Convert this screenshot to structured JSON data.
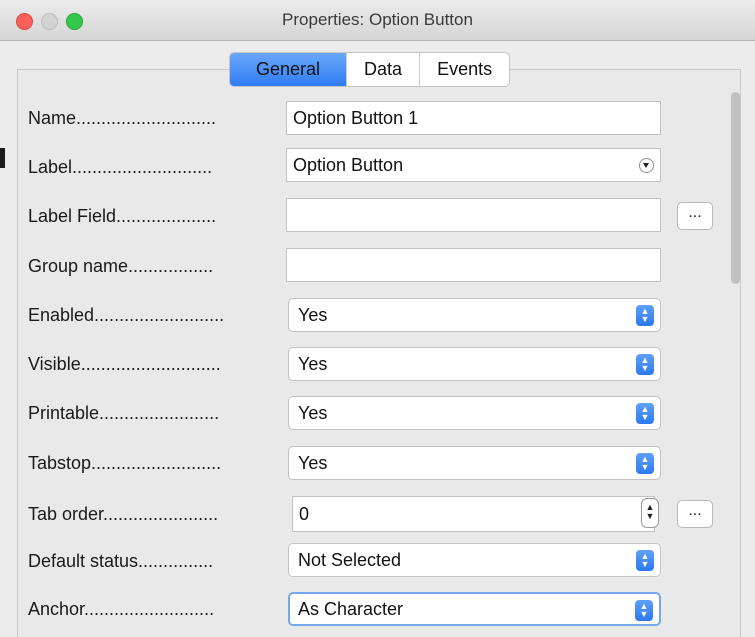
{
  "window": {
    "title": "Properties: Option Button"
  },
  "tabs": [
    {
      "label": "General",
      "active": true
    },
    {
      "label": "Data",
      "active": false
    },
    {
      "label": "Events",
      "active": false
    }
  ],
  "fields": {
    "name": {
      "label": "Name............................",
      "value": "Option Button 1"
    },
    "label": {
      "label": "Label............................",
      "value": "Option Button"
    },
    "label_field": {
      "label": "Label Field....................",
      "value": "",
      "button": "..."
    },
    "group_name": {
      "label": "Group name.................",
      "value": ""
    },
    "enabled": {
      "label": "Enabled..........................",
      "value": "Yes"
    },
    "visible": {
      "label": "Visible............................",
      "value": "Yes"
    },
    "printable": {
      "label": "Printable........................",
      "value": "Yes"
    },
    "tabstop": {
      "label": "Tabstop..........................",
      "value": "Yes"
    },
    "tab_order": {
      "label": "Tab order.......................",
      "value": "0",
      "button": "..."
    },
    "default_status": {
      "label": "Default status...............",
      "value": "Not Selected"
    },
    "anchor": {
      "label": "Anchor..........................",
      "value": "As Character"
    }
  },
  "icons": {
    "close": "close-icon",
    "minimize": "minimize-icon",
    "maximize": "maximize-icon",
    "dropdown": "chevron-down-icon",
    "updown": "updown-chevron-icon",
    "spinner": "spinner-icon"
  },
  "colors": {
    "accent": "#2f7cf3",
    "close": "#fc605c",
    "maximize": "#34c84a"
  }
}
